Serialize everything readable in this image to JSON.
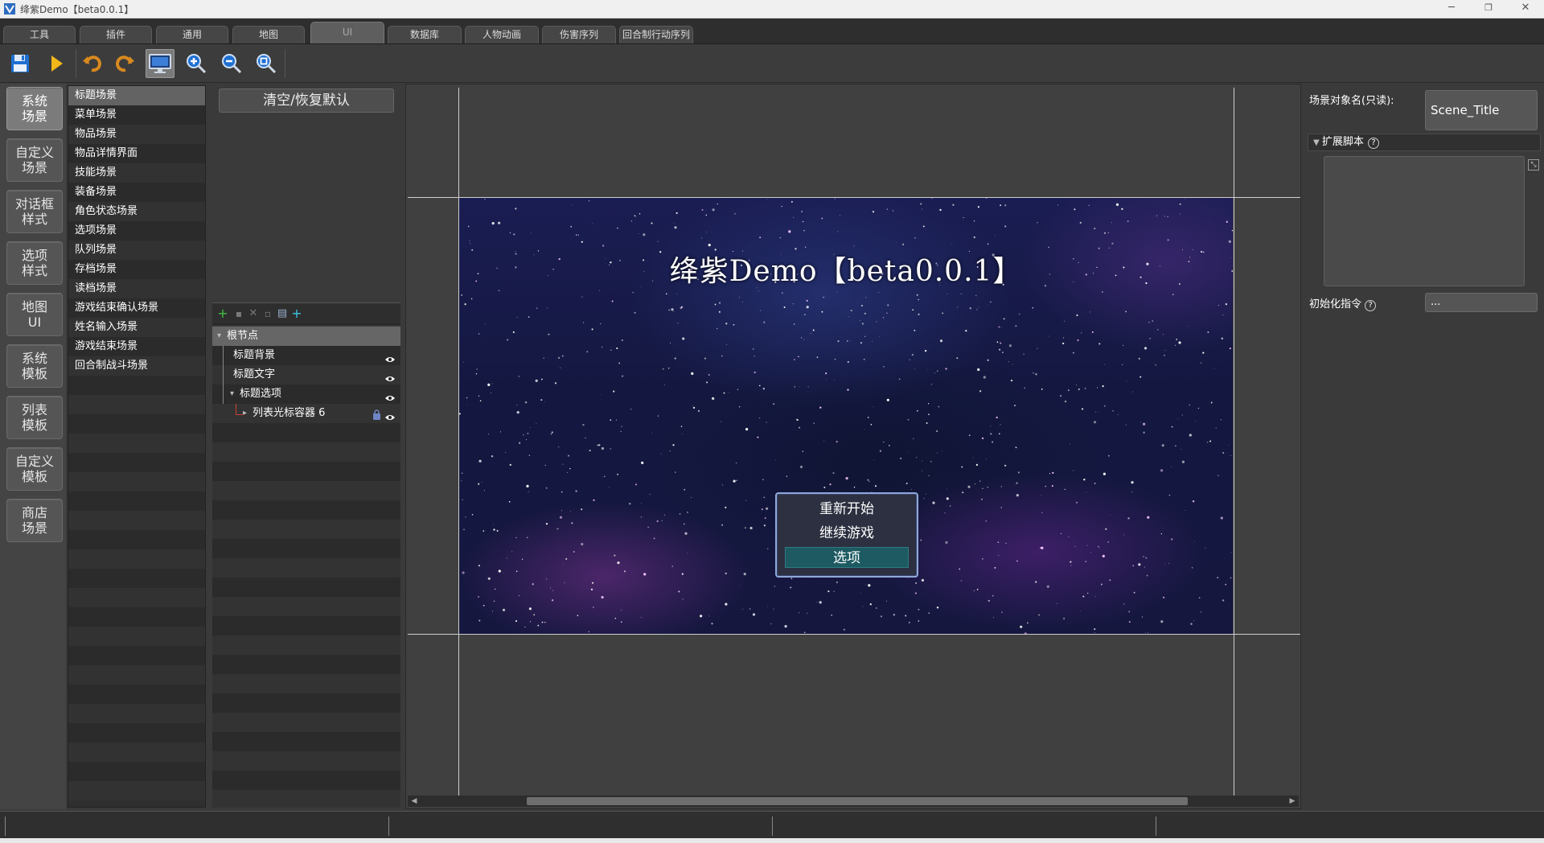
{
  "window": {
    "title": "绛紫Demo【beta0.0.1】",
    "minimize": "─",
    "restore": "❐",
    "close": "✕"
  },
  "menu_tabs": [
    "工具",
    "插件",
    "通用",
    "地图",
    "UI",
    "数据库",
    "人物动画",
    "伤害序列",
    "回合制行动序列"
  ],
  "active_tab": "UI",
  "toolbar": {
    "tools": [
      "save-icon",
      "play-icon",
      "undo-icon",
      "redo-icon",
      "screen-preview-icon",
      "zoom-in-icon",
      "zoom-out-icon",
      "zoom-fit-icon"
    ]
  },
  "categories": [
    {
      "line1": "系统",
      "line2": "场景"
    },
    {
      "line1": "自定义",
      "line2": "场景"
    },
    {
      "line1": "对话框",
      "line2": "样式"
    },
    {
      "line1": "选项",
      "line2": "样式"
    },
    {
      "line1": "地图",
      "line2": "UI"
    },
    {
      "line1": "系统",
      "line2": "模板"
    },
    {
      "line1": "列表",
      "line2": "模板"
    },
    {
      "line1": "自定义",
      "line2": "模板"
    },
    {
      "line1": "商店",
      "line2": "场景"
    }
  ],
  "active_category": 0,
  "scenes": [
    "标题场景",
    "菜单场景",
    "物品场景",
    "物品详情界面",
    "技能场景",
    "装备场景",
    "角色状态场景",
    "选项场景",
    "队列场景",
    "存档场景",
    "读档场景",
    "游戏结束确认场景",
    "姓名输入场景",
    "游戏结束场景",
    "回合制战斗场景"
  ],
  "selected_scene": 0,
  "node_panel": {
    "clear_button": "清空/恢复默认",
    "tree": [
      {
        "label": "根节点",
        "indent": 0,
        "expander": "▾",
        "eye": false,
        "lock": false
      },
      {
        "label": "标题背景",
        "indent": 1,
        "expander": "",
        "eye": true,
        "lock": false
      },
      {
        "label": "标题文字",
        "indent": 1,
        "expander": "",
        "eye": true,
        "lock": false
      },
      {
        "label": "标题选项",
        "indent": 1,
        "expander": "▾",
        "eye": true,
        "lock": false
      },
      {
        "label": "列表光标容器 6",
        "indent": 2,
        "expander": "▸",
        "eye": true,
        "lock": true
      }
    ]
  },
  "canvas": {
    "scene_title": "绛紫Demo【beta0.0.1】",
    "menu_items": [
      "重新开始",
      "继续游戏",
      "选项"
    ],
    "selected_menu_item": 2
  },
  "properties": {
    "scene_name_label": "场景对象名(只读):",
    "scene_name_value": "Scene_Title",
    "ext_script_label": "扩展脚本",
    "help_glyph": "?",
    "init_cmd_label": "初始化指令",
    "init_cmd_value": "..."
  },
  "colors": {
    "selected_menu_bg": "#1d5a62",
    "menu_border": "#8fa8d8",
    "accent_green": "#3fbf3f",
    "accent_cyan": "#3fc3e0"
  }
}
